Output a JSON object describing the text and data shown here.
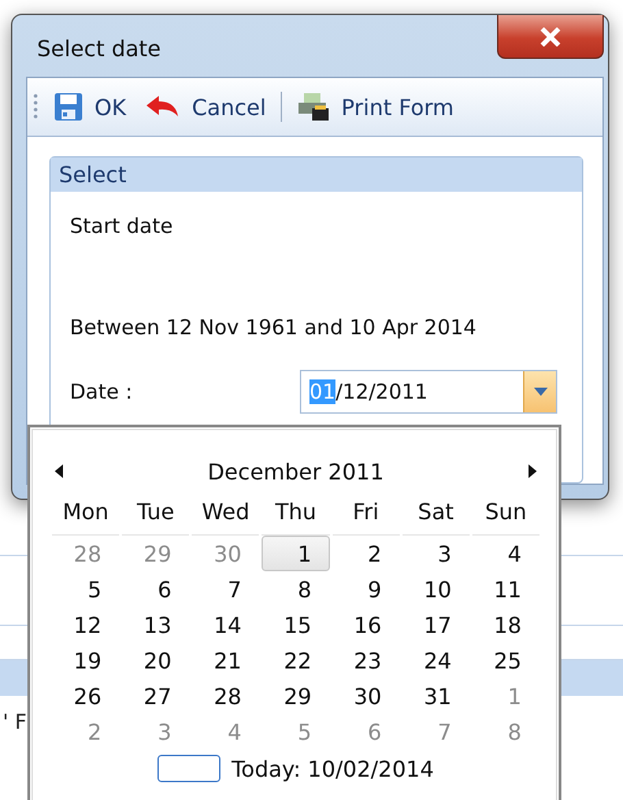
{
  "window": {
    "title": "Select date"
  },
  "toolbar": [
    {
      "kind": "save",
      "label": "OK"
    },
    {
      "kind": "undo",
      "label": "Cancel"
    },
    {
      "kind": "print",
      "label": "Print Form"
    }
  ],
  "group": {
    "title": "Select",
    "heading": "Start date",
    "range": "Between 12 Nov 1961 and 10 Apr 2014",
    "date_label": "Date :",
    "date_value_selected": "01",
    "date_value_rest": "/12/2011"
  },
  "background": {
    "fragment": "' F"
  },
  "calendar": {
    "month": "December 2011",
    "weekdays": [
      "Mon",
      "Tue",
      "Wed",
      "Thu",
      "Fri",
      "Sat",
      "Sun"
    ],
    "weeks": [
      [
        {
          "day": "28",
          "other": true,
          "selected": false
        },
        {
          "day": "29",
          "other": true,
          "selected": false
        },
        {
          "day": "30",
          "other": true,
          "selected": false
        },
        {
          "day": "1",
          "other": false,
          "selected": true
        },
        {
          "day": "2",
          "other": false,
          "selected": false
        },
        {
          "day": "3",
          "other": false,
          "selected": false
        },
        {
          "day": "4",
          "other": false,
          "selected": false
        }
      ],
      [
        {
          "day": "5",
          "other": false,
          "selected": false
        },
        {
          "day": "6",
          "other": false,
          "selected": false
        },
        {
          "day": "7",
          "other": false,
          "selected": false
        },
        {
          "day": "8",
          "other": false,
          "selected": false
        },
        {
          "day": "9",
          "other": false,
          "selected": false
        },
        {
          "day": "10",
          "other": false,
          "selected": false
        },
        {
          "day": "11",
          "other": false,
          "selected": false
        }
      ],
      [
        {
          "day": "12",
          "other": false,
          "selected": false
        },
        {
          "day": "13",
          "other": false,
          "selected": false
        },
        {
          "day": "14",
          "other": false,
          "selected": false
        },
        {
          "day": "15",
          "other": false,
          "selected": false
        },
        {
          "day": "16",
          "other": false,
          "selected": false
        },
        {
          "day": "17",
          "other": false,
          "selected": false
        },
        {
          "day": "18",
          "other": false,
          "selected": false
        }
      ],
      [
        {
          "day": "19",
          "other": false,
          "selected": false
        },
        {
          "day": "20",
          "other": false,
          "selected": false
        },
        {
          "day": "21",
          "other": false,
          "selected": false
        },
        {
          "day": "22",
          "other": false,
          "selected": false
        },
        {
          "day": "23",
          "other": false,
          "selected": false
        },
        {
          "day": "24",
          "other": false,
          "selected": false
        },
        {
          "day": "25",
          "other": false,
          "selected": false
        }
      ],
      [
        {
          "day": "26",
          "other": false,
          "selected": false
        },
        {
          "day": "27",
          "other": false,
          "selected": false
        },
        {
          "day": "28",
          "other": false,
          "selected": false
        },
        {
          "day": "29",
          "other": false,
          "selected": false
        },
        {
          "day": "30",
          "other": false,
          "selected": false
        },
        {
          "day": "31",
          "other": false,
          "selected": false
        },
        {
          "day": "1",
          "other": true,
          "selected": false
        }
      ],
      [
        {
          "day": "2",
          "other": true,
          "selected": false
        },
        {
          "day": "3",
          "other": true,
          "selected": false
        },
        {
          "day": "4",
          "other": true,
          "selected": false
        },
        {
          "day": "5",
          "other": true,
          "selected": false
        },
        {
          "day": "6",
          "other": true,
          "selected": false
        },
        {
          "day": "7",
          "other": true,
          "selected": false
        },
        {
          "day": "8",
          "other": true,
          "selected": false
        }
      ]
    ],
    "today": "Today: 10/02/2014"
  }
}
